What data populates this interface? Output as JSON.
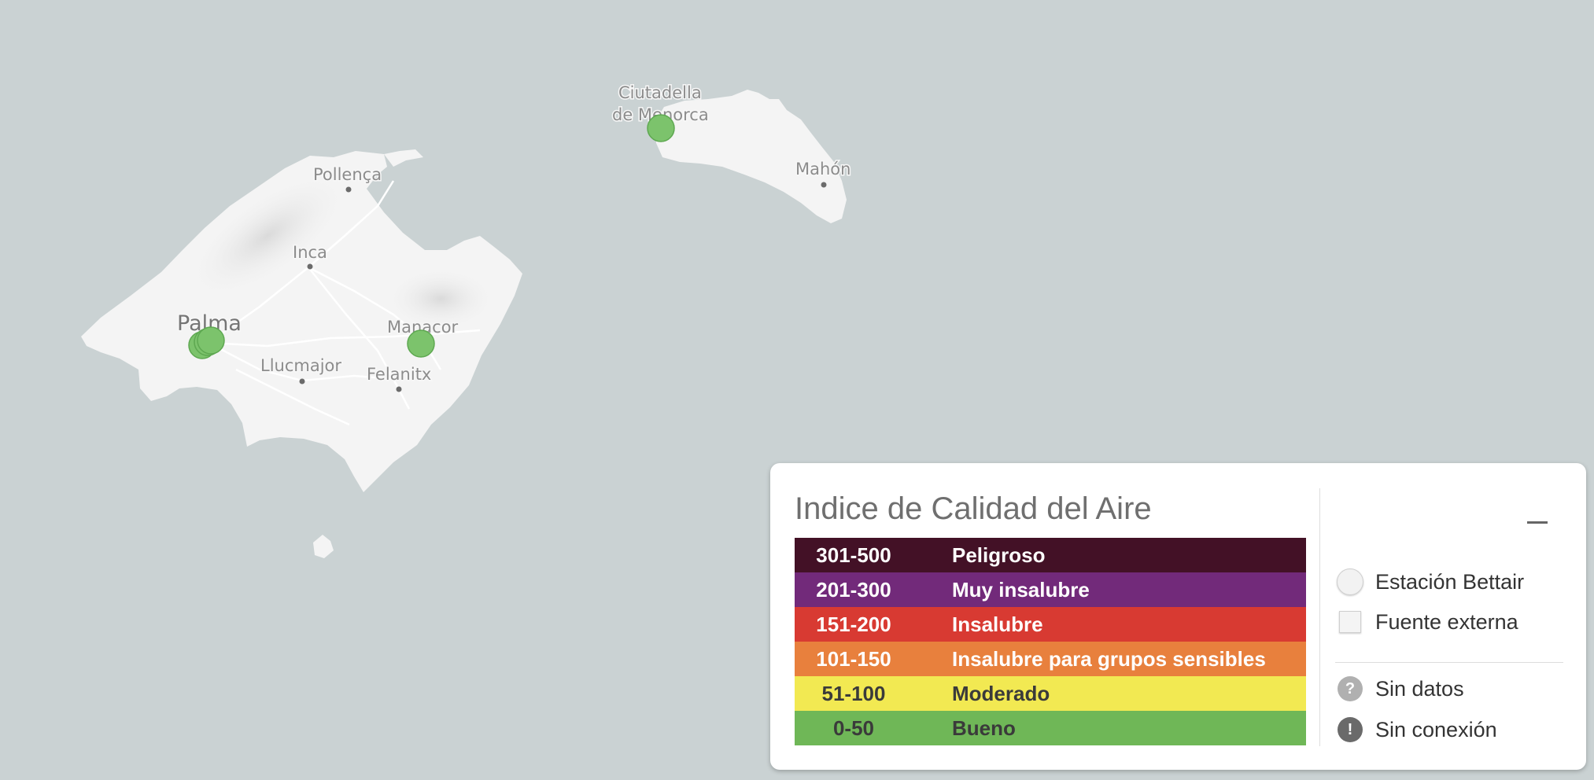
{
  "map": {
    "places": [
      {
        "id": "ciutadella-line1",
        "label": "Ciutadella"
      },
      {
        "id": "ciutadella-line2",
        "label": "de Menorca"
      },
      {
        "id": "mahon",
        "label": "Mahón"
      },
      {
        "id": "pollenca",
        "label": "Pollença"
      },
      {
        "id": "inca",
        "label": "Inca"
      },
      {
        "id": "palma",
        "label": "Palma"
      },
      {
        "id": "manacor",
        "label": "Manacor"
      },
      {
        "id": "llucmajor",
        "label": "Llucmajor"
      },
      {
        "id": "felanitx",
        "label": "Felanitx"
      }
    ],
    "station_color": "#7cc36c"
  },
  "legend": {
    "title": "Indice de Calidad del Aire",
    "minimize_icon": "minimize-icon",
    "aqi_levels": [
      {
        "range": "301-500",
        "label": "Peligroso",
        "color": "#431126",
        "text_color": "#ffffff"
      },
      {
        "range": "201-300",
        "label": "Muy insalubre",
        "color": "#722a7a",
        "text_color": "#ffffff"
      },
      {
        "range": "151-200",
        "label": "Insalubre",
        "color": "#d83a32",
        "text_color": "#ffffff"
      },
      {
        "range": "101-150",
        "label": "Insalubre para grupos sensibles",
        "color": "#e8803d",
        "text_color": "#ffffff"
      },
      {
        "range": "51-100",
        "label": "Moderado",
        "color": "#f2e952",
        "text_color": "#3a3a3a"
      },
      {
        "range": "0-50",
        "label": "Bueno",
        "color": "#6fb757",
        "text_color": "#3a3a3a"
      }
    ],
    "keys": [
      {
        "icon": "circle-icon",
        "label": "Estación Bettair"
      },
      {
        "icon": "square-icon",
        "label": "Fuente externa"
      },
      {
        "icon": "question-icon",
        "label": "Sin datos",
        "glyph": "?"
      },
      {
        "icon": "exclamation-icon",
        "label": "Sin conexión",
        "glyph": "!"
      }
    ]
  }
}
